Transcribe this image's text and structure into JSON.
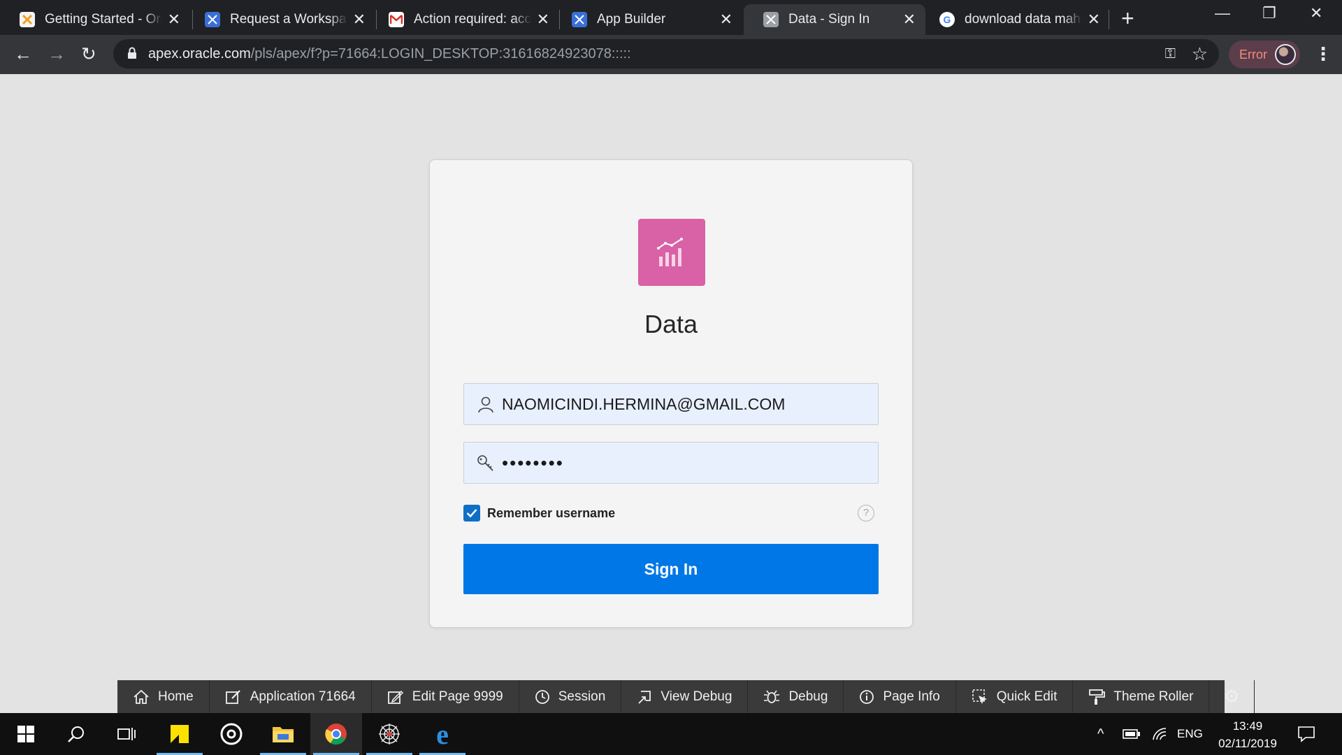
{
  "browser": {
    "tabs": [
      {
        "title": "Getting Started - Oracle",
        "icon": "apex-orange-icon"
      },
      {
        "title": "Request a Workspace",
        "icon": "apex-blue-icon"
      },
      {
        "title": "Action required: account",
        "icon": "gmail-icon"
      },
      {
        "title": "App Builder",
        "icon": "apex-blue-icon"
      },
      {
        "title": "Data - Sign In",
        "icon": "apex-grey-icon",
        "active": true
      },
      {
        "title": "download data maha",
        "icon": "google-icon"
      }
    ],
    "url_host": "apex.oracle.com",
    "url_path": "/pls/apex/f?p=71664:LOGIN_DESKTOP:31616824923078:::::",
    "profile_status": "Error"
  },
  "login": {
    "app_title": "Data",
    "username_value": "NAOMICINDI.HERMINA@GMAIL.COM",
    "password_value": "••••••••",
    "remember_label": "Remember username",
    "remember_checked": true,
    "help_symbol": "?",
    "signin_label": "Sign In",
    "logo_color": "#d961a6",
    "button_color": "#0077e6"
  },
  "devbar": {
    "items": [
      {
        "label": "Home",
        "icon": "home-icon"
      },
      {
        "label": "Application 71664",
        "icon": "edit-icon"
      },
      {
        "label": "Edit Page 9999",
        "icon": "edit-page-icon"
      },
      {
        "label": "Session",
        "icon": "clock-icon"
      },
      {
        "label": "View Debug",
        "icon": "view-debug-icon"
      },
      {
        "label": "Debug",
        "icon": "bug-icon"
      },
      {
        "label": "Page Info",
        "icon": "info-icon"
      },
      {
        "label": "Quick Edit",
        "icon": "quick-edit-icon"
      },
      {
        "label": "Theme Roller",
        "icon": "paint-roller-icon"
      }
    ]
  },
  "taskbar": {
    "language": "ENG",
    "time": "13:49",
    "date": "02/11/2019"
  }
}
